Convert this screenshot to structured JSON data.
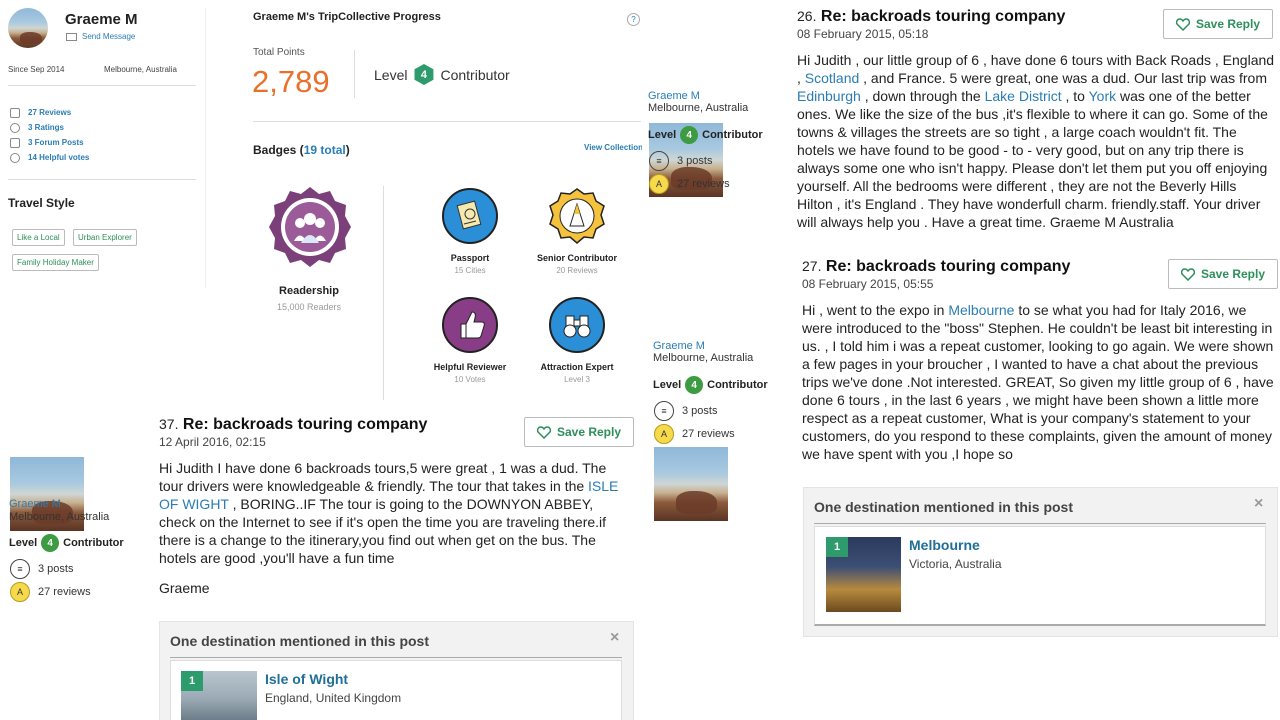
{
  "profile": {
    "name": "Graeme M",
    "send_message": "Send Message",
    "since": "Since Sep 2014",
    "location": "Melbourne, Australia",
    "stats": [
      "27 Reviews",
      "3 Ratings",
      "3 Forum Posts",
      "14 Helpful votes"
    ],
    "travel_style_heading": "Travel Style",
    "tags": [
      "Like a Local",
      "Urban Explorer",
      "Family Holiday Maker"
    ]
  },
  "progress": {
    "heading": "Graeme M's TripCollective Progress",
    "help": "?",
    "total_points_label": "Total Points",
    "total_points": "2,789",
    "level_label": "Level",
    "level_num": "4",
    "level_title": "Contributor",
    "badges_label": "Badges (",
    "badges_total": "19 total",
    "badges_close": ")",
    "view_collection": "View Collection",
    "badges": [
      {
        "title": "Readership",
        "sub": "15,000 Readers",
        "icon": "readership-icon"
      },
      {
        "title": "Passport",
        "sub": "15 Cities",
        "icon": "passport-icon"
      },
      {
        "title": "Senior Contributor",
        "sub": "20 Reviews",
        "icon": "senior-contributor-icon"
      },
      {
        "title": "Helpful Reviewer",
        "sub": "10 Votes",
        "icon": "thumbs-up-icon"
      },
      {
        "title": "Attraction Expert",
        "sub": "Level 3",
        "icon": "binoculars-icon"
      }
    ]
  },
  "user_card": {
    "name": "Graeme M",
    "location": "Melbourne, Australia",
    "level_label": "Level",
    "level_num": "4",
    "level_title": "Contributor",
    "posts": "3 posts",
    "reviews": "27 reviews"
  },
  "posts": [
    {
      "num": "37.",
      "title": "Re: backroads touring company",
      "date": "12 April 2016, 02:15",
      "save": "Save Reply",
      "body_parts": [
        {
          "t": "Hi Judith I have done 6 backroads tours,5 were great , 1 was a dud. The tour drivers were knowledgeable & friendly. The tour that takes in the ",
          "link": false
        },
        {
          "t": "ISLE OF WIGHT",
          "link": true
        },
        {
          "t": " , BORING..IF The tour is going to the DOWNYON ABBEY, check on the Internet to see if it's open the time you are traveling there.if there is a change to the itinerary,you find out when get on the bus. The hotels are good ,you'll have a fun time",
          "link": false
        }
      ],
      "signoff": "Graeme",
      "dest_heading": "One destination mentioned in this post",
      "dest_rank": "1",
      "dest_name": "Isle of Wight",
      "dest_loc": "England, United Kingdom"
    },
    {
      "num": "26.",
      "title": "Re: backroads touring company",
      "date": "08 February 2015, 05:18",
      "save": "Save Reply",
      "body_parts": [
        {
          "t": "Hi Judith , our little group of 6 , have done 6 tours with Back Roads , England , ",
          "link": false
        },
        {
          "t": "Scotland",
          "link": true
        },
        {
          "t": " , and France. 5 were great, one was a dud. Our last trip was from ",
          "link": false
        },
        {
          "t": "Edinburgh",
          "link": true
        },
        {
          "t": " , down through the ",
          "link": false
        },
        {
          "t": "Lake District",
          "link": true
        },
        {
          "t": " , to ",
          "link": false
        },
        {
          "t": "York",
          "link": true
        },
        {
          "t": " was one of the better ones. We like the size of the bus ,it's flexible to where it can go. Some of the towns & villages the streets are so tight , a large coach wouldn't fit. The hotels we have found to be good - to - very good, but on any trip there is always some one who isn't happy. Please don't let them put you off enjoying yourself. All the bedrooms were different , they are not the Beverly Hills Hilton , it's England . They have wonderfull charm. friendly.staff. Your driver will always help you . Have a great time. Graeme M Australia",
          "link": false
        }
      ]
    },
    {
      "num": "27.",
      "title": "Re: backroads touring company",
      "date": "08 February 2015, 05:55",
      "save": "Save Reply",
      "body_parts": [
        {
          "t": "Hi , went to the expo in ",
          "link": false
        },
        {
          "t": "Melbourne",
          "link": true
        },
        {
          "t": " to se what you had for Italy 2016, we were introduced to the \"boss\" Stephen. He couldn't be least bit interesting in us. , I told him i was a repeat customer, looking to go again. We were shown a few pages in your broucher , I wanted to have a chat about the previous trips we've done .Not interested. GREAT, So given my little group of 6 , have done 6 tours , in the last 6 years , we might have been shown a little more respect as a repeat customer, What is your company's statement to your customers, do you respond to these complaints, given the amount of money we have spent with you ,I hope so",
          "link": false
        }
      ],
      "dest_heading": "One destination mentioned in this post",
      "dest_rank": "1",
      "dest_name": "Melbourne",
      "dest_loc": "Victoria, Australia"
    }
  ],
  "colors": {
    "accent_green": "#3d9b42",
    "points_orange": "#e8702a",
    "link_blue": "#2a7db5"
  }
}
